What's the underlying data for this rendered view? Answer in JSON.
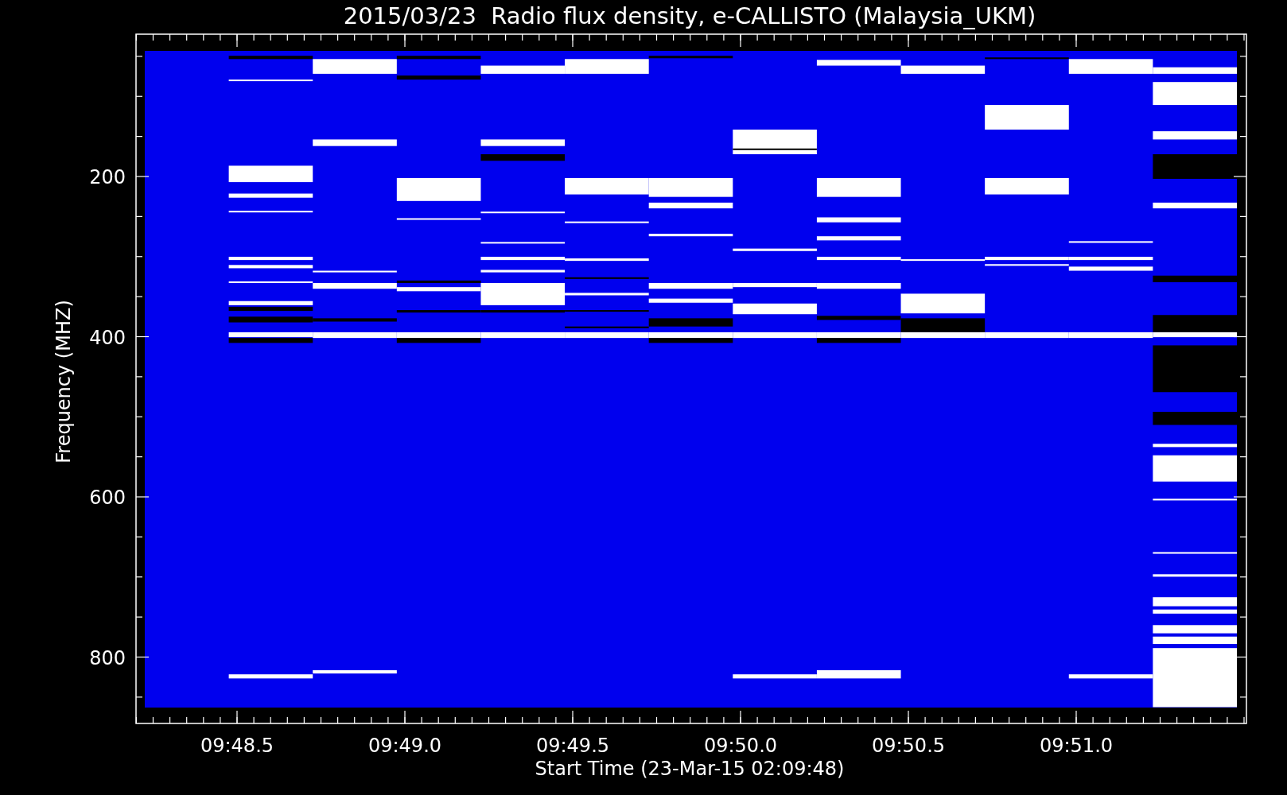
{
  "title": "2015/03/23  Radio flux density, e-CALLISTO (Malaysia_UKM)",
  "y_axis": {
    "label": "Frequency (MHZ)",
    "ticks": [
      "200",
      "400",
      "600",
      "800"
    ]
  },
  "x_axis": {
    "label": "Start Time (23-Mar-15 02:09:48)",
    "ticks": [
      "09:48.5",
      "09:49.0",
      "09:49.5",
      "09:50.0",
      "09:50.5",
      "09:51.0"
    ]
  }
}
